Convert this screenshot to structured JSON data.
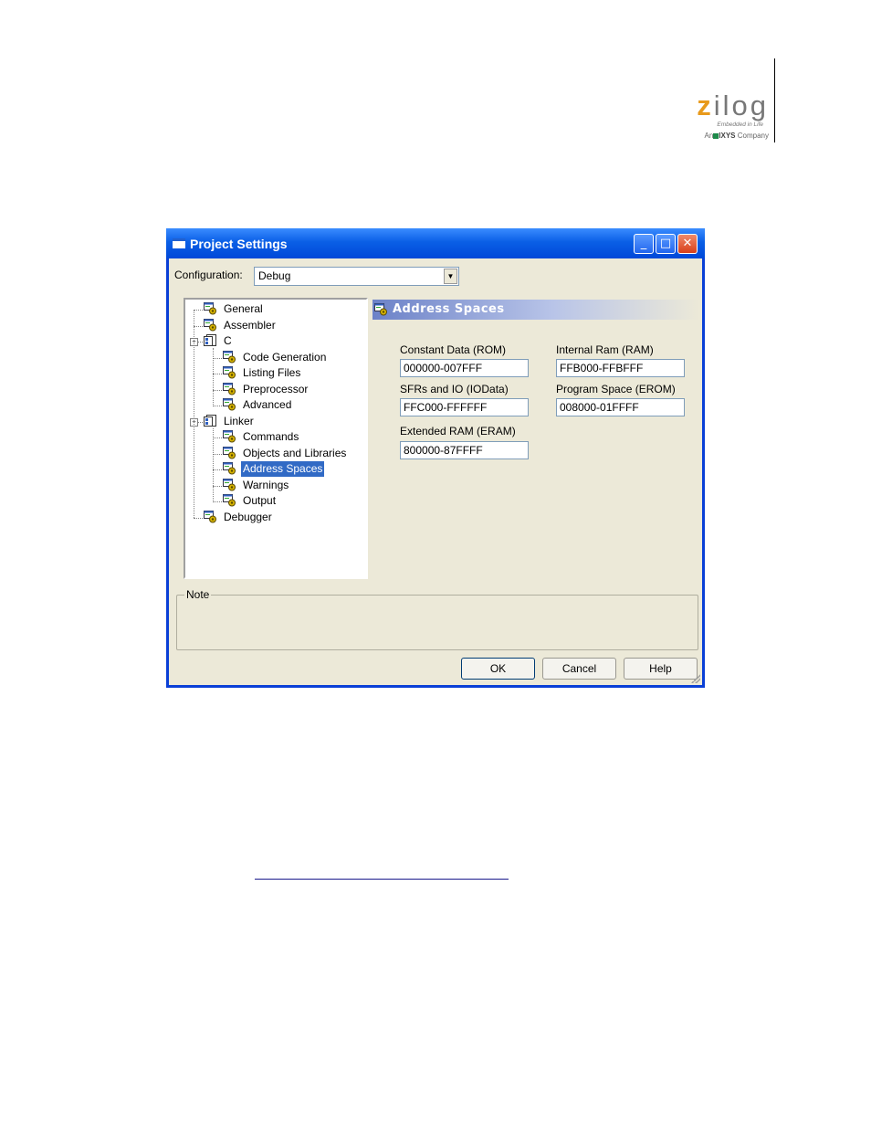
{
  "logo": {
    "word_first": "z",
    "word_rest": "ilog",
    "tagline": "Embedded in Life",
    "company_prefix": "An",
    "company_name": "IXYS",
    "company_suffix": "Company"
  },
  "window": {
    "title": "Project Settings",
    "buttons": {
      "minimize": "_",
      "maximize": "□",
      "close": "✕"
    }
  },
  "configuration": {
    "label": "Configuration:",
    "value": "Debug"
  },
  "tree": [
    {
      "label": "General",
      "icon": "settings-page-icon"
    },
    {
      "label": "Assembler",
      "icon": "settings-page-icon"
    },
    {
      "label": "C",
      "icon": "folder-pages-icon",
      "expanded": true
    },
    {
      "label": "Code Generation",
      "icon": "settings-page-icon"
    },
    {
      "label": "Listing Files",
      "icon": "settings-page-icon"
    },
    {
      "label": "Preprocessor",
      "icon": "settings-page-icon"
    },
    {
      "label": "Advanced",
      "icon": "settings-page-icon"
    },
    {
      "label": "Linker",
      "icon": "folder-pages-icon",
      "expanded": true
    },
    {
      "label": "Commands",
      "icon": "settings-page-icon"
    },
    {
      "label": "Objects and Libraries",
      "icon": "settings-page-icon"
    },
    {
      "label": "Address Spaces",
      "icon": "settings-page-icon",
      "selected": true
    },
    {
      "label": "Warnings",
      "icon": "settings-page-icon"
    },
    {
      "label": "Output",
      "icon": "settings-page-icon"
    },
    {
      "label": "Debugger",
      "icon": "settings-page-icon"
    }
  ],
  "page": {
    "title": "Address Spaces",
    "fields": {
      "rom": {
        "label": "Constant Data (ROM)",
        "value": "000000-007FFF"
      },
      "ram": {
        "label": "Internal Ram (RAM)",
        "value": "FFB000-FFBFFF"
      },
      "iodata": {
        "label": "SFRs and IO (IOData)",
        "value": "FFC000-FFFFFF"
      },
      "erom": {
        "label": "Program Space (EROM)",
        "value": "008000-01FFFF"
      },
      "eram": {
        "label": "Extended RAM (ERAM)",
        "value": "800000-87FFFF"
      }
    }
  },
  "note": {
    "label": "Note"
  },
  "buttons": {
    "ok": "OK",
    "cancel": "Cancel",
    "help": "Help"
  },
  "colors": {
    "titlebar": "#0a5fe6",
    "selection": "#316ac5",
    "dialog_bg": "#ece9d8",
    "logo_accent": "#e89a1c"
  }
}
